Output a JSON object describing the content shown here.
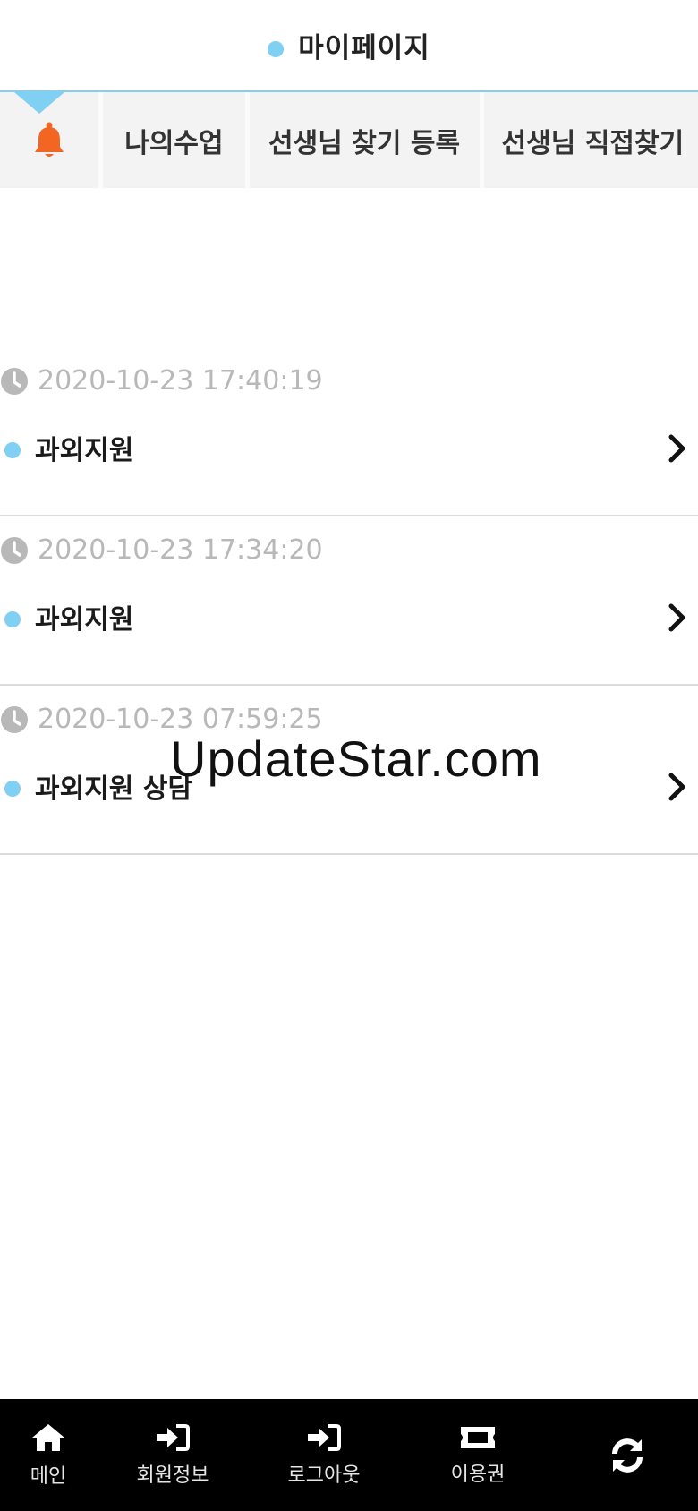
{
  "header": {
    "title": "마이페이지"
  },
  "tabs": [
    {
      "label": "나의수업"
    },
    {
      "label": "선생님 찾기 등록"
    },
    {
      "label": "선생님 직접찾기"
    }
  ],
  "notifications": [
    {
      "time": "2020-10-23 17:40:19",
      "title": "과외지원"
    },
    {
      "time": "2020-10-23 17:34:20",
      "title": "과외지원"
    },
    {
      "time": "2020-10-23 07:59:25",
      "title": "과외지원 상담"
    }
  ],
  "watermark": "UpdateStar.com",
  "bottom_nav": {
    "main": "메인",
    "member_info": "회원정보",
    "logout": "로그아웃",
    "ticket": "이용권"
  },
  "colors": {
    "accent": "#7fd0f3",
    "bell": "#f26522",
    "nav_bg": "#000000"
  }
}
